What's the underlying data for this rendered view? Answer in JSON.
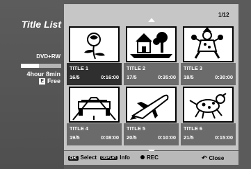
{
  "header": {
    "title": "Title List",
    "page_indicator": "1/12"
  },
  "disc": {
    "media": "DVD+RW",
    "remaining_time": "4hour 8min",
    "free_badge": "E",
    "free_label": "Free",
    "used_fraction": 0.45
  },
  "titles": [
    {
      "name": "TITLE  1",
      "date": "16/5",
      "duration": "0:16:00",
      "selected": true,
      "thumb_icon": "rose-icon"
    },
    {
      "name": "TITLE  2",
      "date": "17/5",
      "duration": "0:35:00",
      "selected": false,
      "thumb_icon": "house-icon"
    },
    {
      "name": "TITLE  3",
      "date": "18/5",
      "duration": "0:30:00",
      "selected": false,
      "thumb_icon": "clown-icon"
    },
    {
      "name": "TITLE  4",
      "date": "19/5",
      "duration": "0:08:00",
      "selected": false,
      "thumb_icon": "car-road-icon"
    },
    {
      "name": "TITLE  5",
      "date": "20/5",
      "duration": "0:10:00",
      "selected": false,
      "thumb_icon": "space-shuttle-icon"
    },
    {
      "name": "TITLE  6",
      "date": "21/5",
      "duration": "0:15:00",
      "selected": false,
      "thumb_icon": "dalmatian-icon"
    }
  ],
  "footer": {
    "ok_key": "OK",
    "select_label": "Select",
    "display_key": "DISPLAY",
    "info_label": "Info",
    "rec_label": "REC",
    "close_label": "Close"
  }
}
